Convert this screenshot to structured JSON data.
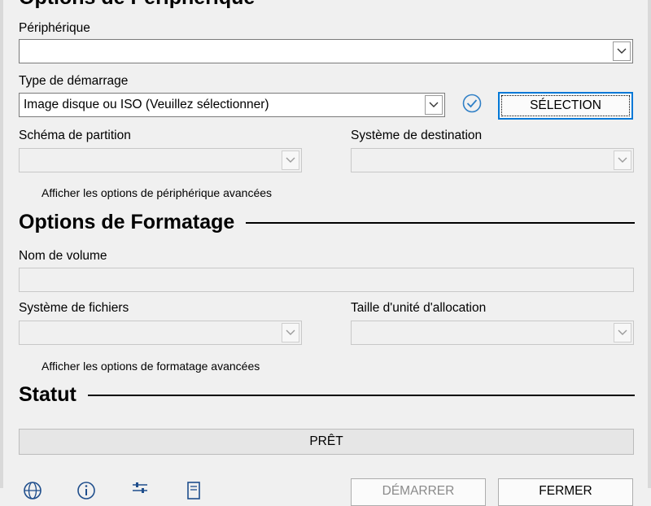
{
  "device_options": {
    "title": "Options de Périphérique",
    "device_label": "Périphérique",
    "device_value": "",
    "boot_type_label": "Type de démarrage",
    "boot_type_value": "Image disque ou ISO (Veuillez sélectionner)",
    "select_button": "SÉLECTION",
    "partition_scheme_label": "Schéma de partition",
    "partition_scheme_value": "",
    "target_system_label": "Système de destination",
    "target_system_value": "",
    "advanced_link": "Afficher les options de périphérique avancées"
  },
  "format_options": {
    "title": "Options de Formatage",
    "volume_label_label": "Nom de volume",
    "volume_label_value": "",
    "file_system_label": "Système de fichiers",
    "file_system_value": "",
    "cluster_size_label": "Taille d'unité d'allocation",
    "cluster_size_value": "",
    "advanced_link": "Afficher les options de formatage avancées"
  },
  "status": {
    "title": "Statut",
    "progress_text": "PRÊT",
    "progress_fraction": 0
  },
  "footer": {
    "start_button": "DÉMARRER",
    "close_button": "FERMER",
    "icons": [
      "globe-icon",
      "info-icon",
      "settings-sliders-icon",
      "log-icon"
    ]
  },
  "colors": {
    "accent": "#0078d7",
    "check": "#2f7fc6",
    "progress_fill": "#06b025"
  }
}
